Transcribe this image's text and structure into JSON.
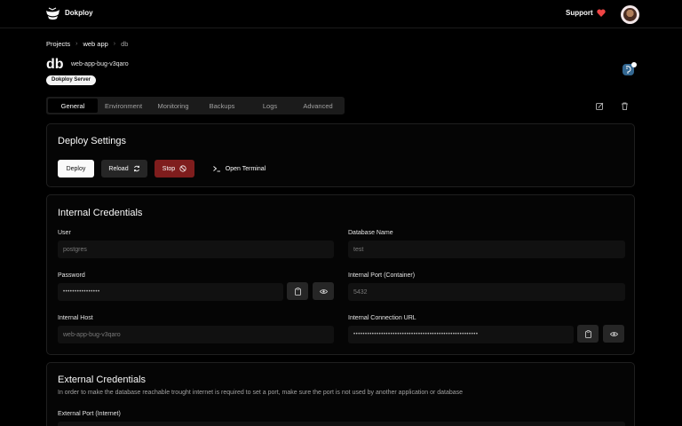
{
  "header": {
    "brand": "Dokploy",
    "support_label": "Support"
  },
  "breadcrumb": {
    "items": [
      "Projects",
      "web app",
      "db"
    ]
  },
  "service": {
    "title": "db",
    "app_name": "web-app-bug-v3qaro",
    "server_badge": "Dokploy Server"
  },
  "tabs": [
    "General",
    "Environment",
    "Monitoring",
    "Backups",
    "Logs",
    "Advanced"
  ],
  "deploy": {
    "title": "Deploy Settings",
    "deploy_label": "Deploy",
    "reload_label": "Reload",
    "stop_label": "Stop",
    "terminal_label": "Open Terminal"
  },
  "internal": {
    "title": "Internal Credentials",
    "user_label": "User",
    "user_value": "postgres",
    "dbname_label": "Database Name",
    "dbname_value": "test",
    "password_label": "Password",
    "password_value": "••••••••••••••••",
    "port_label": "Internal Port (Container)",
    "port_value": "5432",
    "host_label": "Internal Host",
    "host_value": "web-app-bug-v3qaro",
    "url_label": "Internal Connection URL",
    "url_value": "••••••••••••••••••••••••••••••••••••••••••••••••••••••"
  },
  "external": {
    "title": "External Credentials",
    "description": "In order to make the database reachable trought internet is required to set a port, make sure the port is not used by another application or database",
    "port_label": "External Port (Internet)"
  },
  "colors": {
    "background": "#000000",
    "stop_button": "#7f1d1d",
    "heart": "#ef4444"
  }
}
